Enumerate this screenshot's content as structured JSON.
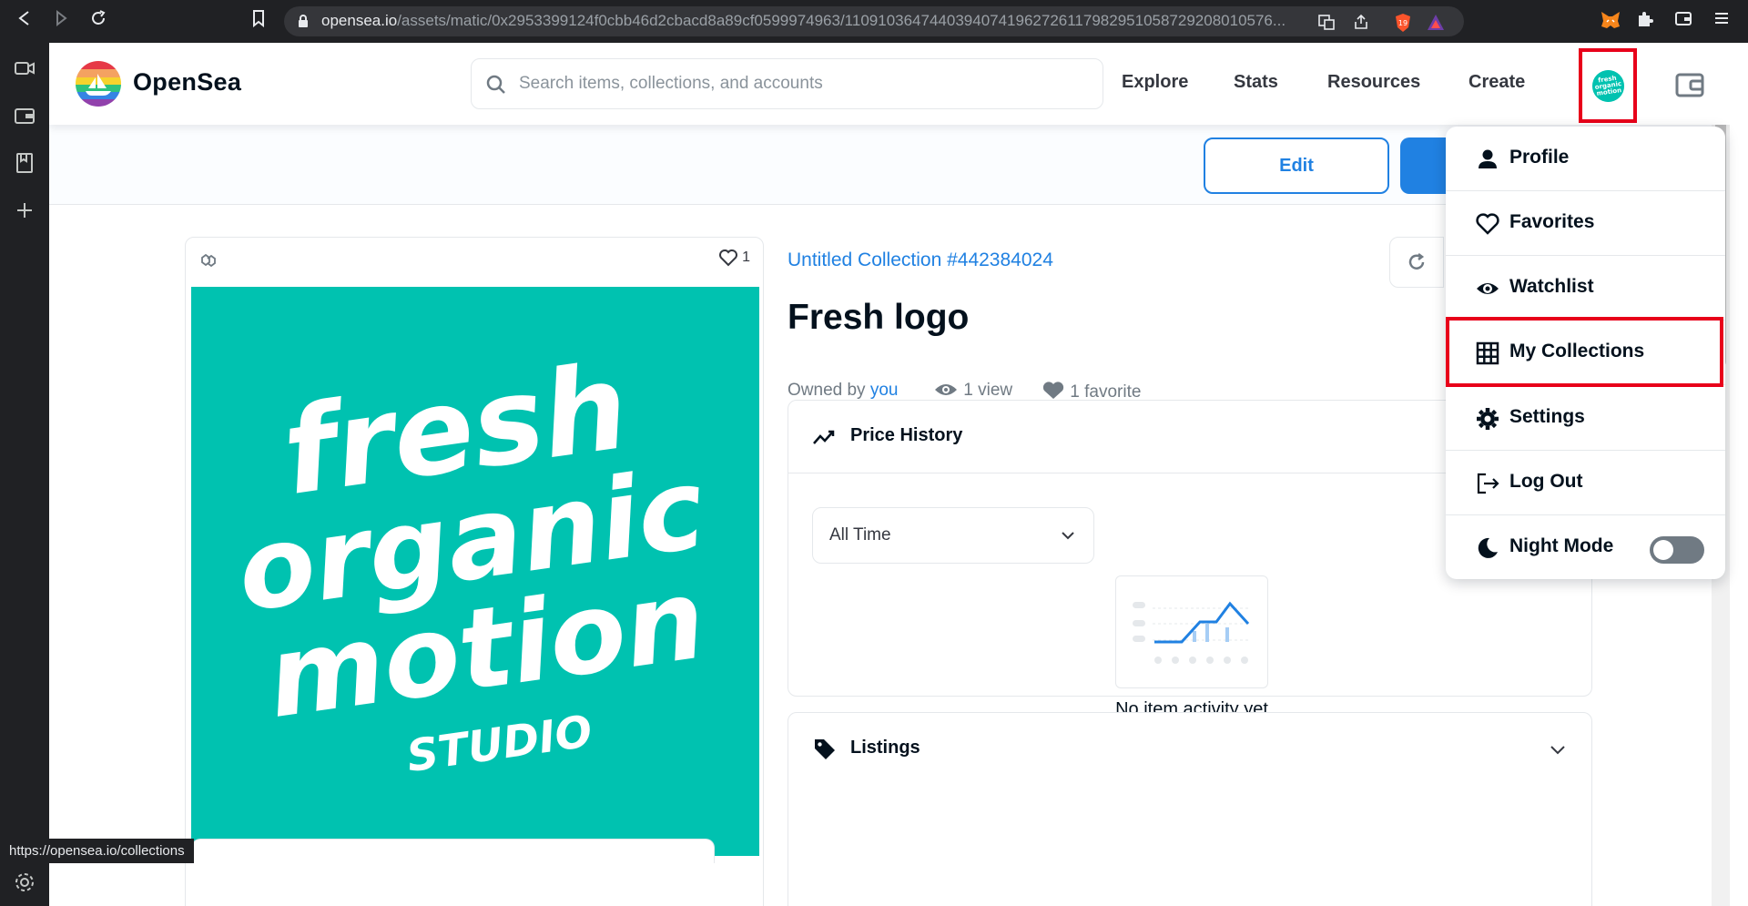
{
  "browser": {
    "url_host": "opensea.io",
    "url_path": "/assets/matic/0x2953399124f0cbb46d2cbacd8a89cf0599974963/11091036474403940741962726117982951058729208010576...",
    "status_url": "https://opensea.io/collections",
    "brave_badge": "19"
  },
  "header": {
    "brand": "OpenSea",
    "search_placeholder": "Search items, collections, and accounts",
    "nav": [
      "Explore",
      "Stats",
      "Resources",
      "Create"
    ]
  },
  "actions": {
    "edit_label": "Edit"
  },
  "asset": {
    "favorite_count": "1",
    "collection_link": "Untitled Collection #442384024",
    "title": "Fresh logo",
    "owned_by_label": "Owned by",
    "owner": "you",
    "views": "1 view",
    "favorites": "1 favorite",
    "image_text": [
      "fresh",
      "organic",
      "motion",
      "STUDIO"
    ]
  },
  "price_history": {
    "title": "Price History",
    "range": "All Time",
    "empty": "No item activity yet"
  },
  "listings": {
    "title": "Listings"
  },
  "menu": {
    "items": [
      {
        "label": "Profile",
        "icon": "person-icon"
      },
      {
        "label": "Favorites",
        "icon": "heart-icon"
      },
      {
        "label": "Watchlist",
        "icon": "eye-icon"
      },
      {
        "label": "My Collections",
        "icon": "grid-icon"
      },
      {
        "label": "Settings",
        "icon": "gear-icon"
      },
      {
        "label": "Log Out",
        "icon": "logout-icon"
      },
      {
        "label": "Night Mode",
        "icon": "moon-icon"
      }
    ],
    "night_mode_on": false
  },
  "colors": {
    "brand_blue": "#2081e2",
    "teal": "#00c2b0",
    "highlight_red": "#e8001a"
  }
}
